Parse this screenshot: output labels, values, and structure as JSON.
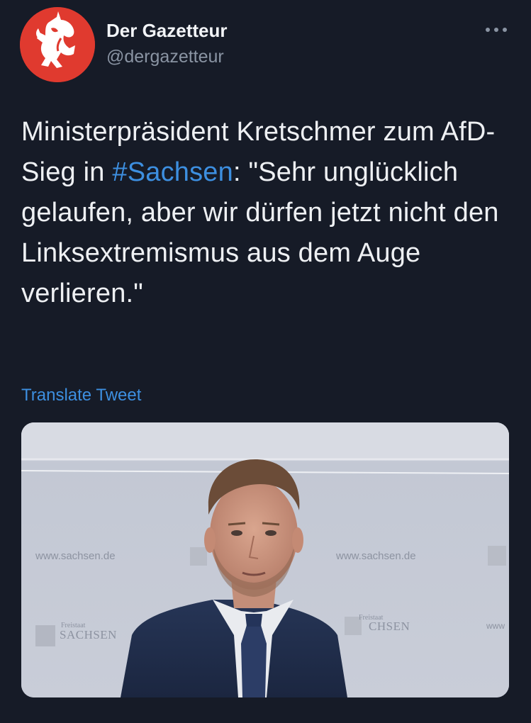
{
  "account": {
    "display_name": "Der Gazetteur",
    "handle": "@dergazetteur",
    "avatar_icon": "unicorn-logo-icon",
    "avatar_color": "#e03a2f"
  },
  "menu": {
    "icon": "more-options-icon"
  },
  "tweet": {
    "text_before": "Ministerpräsident Kretschmer zum AfD-Sieg in ",
    "hashtag": "#Sachsen",
    "text_after": ": \"Sehr unglücklich gelaufen, aber wir dürfen jetzt nicht den Linksextremismus aus dem Auge verlieren.\"",
    "translate_label": "Translate Tweet",
    "link_color": "#3d8fe0"
  },
  "media": {
    "backdrop_text": {
      "url_left": "www.sachsen.de",
      "url_right": "www.sachsen.de",
      "url_edge": "www",
      "freistaat_left": "Freistaat",
      "sachsen_left": "SACHSEN",
      "freistaat_right": "Freistaat",
      "sachsen_right": "CHSEN"
    }
  }
}
